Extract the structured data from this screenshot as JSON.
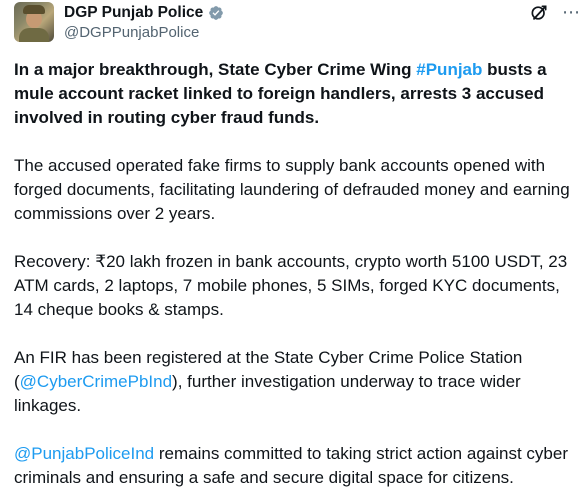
{
  "author": {
    "display_name": "DGP Punjab Police",
    "handle": "@DGPPunjabPolice",
    "verified": true,
    "verified_color": "#829aab"
  },
  "post": {
    "lead": {
      "before": "In a major breakthrough, State Cyber Crime Wing ",
      "hashtag": "#Punjab",
      "after": " busts a mule account racket linked to foreign handlers, arrests 3 accused involved in routing cyber fraud funds."
    },
    "paragraph_2": "The accused operated fake firms to supply bank accounts opened with forged documents, facilitating laundering of defrauded money and earning commissions over 2 years.",
    "paragraph_3": "Recovery: ₹20 lakh frozen in bank accounts, crypto worth 5100 USDT, 23 ATM cards, 2 laptops, 7 mobile phones, 5 SIMs, forged KYC documents, 14 cheque books & stamps.",
    "paragraph_4": {
      "before": "An FIR has been registered at the State Cyber Crime Police Station (",
      "mention": "@CyberCrimePbInd",
      "after": "), further investigation underway to trace wider linkages."
    },
    "paragraph_5": {
      "mention": "@PunjabPoliceInd",
      "after": " remains committed to taking strict action against cyber criminals and ensuring a safe and secure digital space for citizens."
    }
  },
  "colors": {
    "text": "#0f1419",
    "secondary": "#536471",
    "link": "#1d9bf0"
  },
  "icons": [
    "verified-badge-icon",
    "grok-icon",
    "more-icon"
  ]
}
